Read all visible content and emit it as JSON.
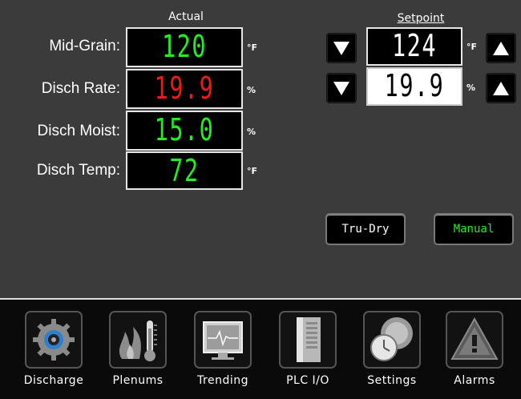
{
  "headers": {
    "actual": "Actual",
    "setpoint": "Setpoint"
  },
  "rows": [
    {
      "label": "Mid-Grain:",
      "value": "120",
      "color": "#22ee22",
      "unit": "°F"
    },
    {
      "label": "Disch Rate:",
      "value": "19.9",
      "color": "#ee1a1a",
      "unit": "%"
    },
    {
      "label": "Disch Moist:",
      "value": "15.0",
      "color": "#22ee22",
      "unit": "%"
    },
    {
      "label": "Disch Temp:",
      "value": "72",
      "color": "#22ee22",
      "unit": "°F"
    }
  ],
  "setpoints": [
    {
      "value": "124",
      "unit": "°F",
      "style": "dark"
    },
    {
      "value": "19.9",
      "unit": "%",
      "style": "light"
    }
  ],
  "modes": {
    "tru_dry": "Tru-Dry",
    "manual": "Manual"
  },
  "colors": {
    "tru_dry_text": "#ffffff",
    "manual_text": "#22ee22"
  },
  "nav": [
    {
      "label": "Discharge",
      "icon": "gear-icon"
    },
    {
      "label": "Plenums",
      "icon": "flame-thermometer-icon"
    },
    {
      "label": "Trending",
      "icon": "trend-monitor-icon"
    },
    {
      "label": "PLC I/O",
      "icon": "plc-cabinet-icon"
    },
    {
      "label": "Settings",
      "icon": "settings-clock-icon"
    },
    {
      "label": "Alarms",
      "icon": "warning-icon"
    }
  ]
}
